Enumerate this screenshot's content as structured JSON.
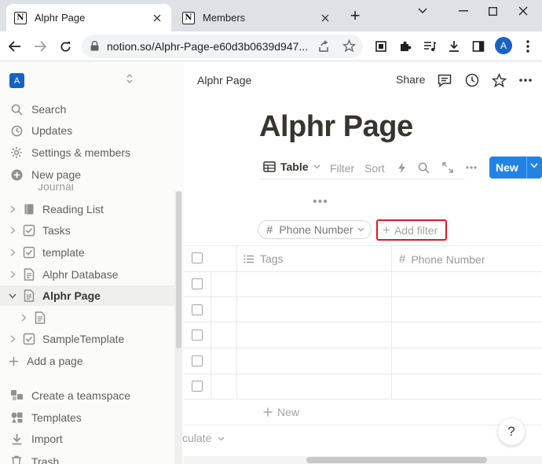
{
  "browser": {
    "tabs": [
      {
        "title": "Alphr Page",
        "active": true
      },
      {
        "title": "Members",
        "active": false
      }
    ],
    "url": "notion.so/Alphr-Page-e60d3b0639d947...",
    "profile_initial": "A"
  },
  "sidebar": {
    "workspace_initial": "A",
    "nav": [
      {
        "label": "Search",
        "icon": "search-icon"
      },
      {
        "label": "Updates",
        "icon": "clock-icon"
      },
      {
        "label": "Settings & members",
        "icon": "gear-icon"
      },
      {
        "label": "New page",
        "icon": "plus-circle-icon"
      }
    ],
    "partial_item": "Journal",
    "pages": [
      {
        "label": "Reading List",
        "icon": "book-icon"
      },
      {
        "label": "Tasks",
        "icon": "checkbox-icon"
      },
      {
        "label": "template",
        "icon": "checkbox-icon"
      },
      {
        "label": "Alphr Database",
        "icon": "page-icon"
      },
      {
        "label": "Alphr Page",
        "icon": "page-icon",
        "active": true,
        "expanded": true
      },
      {
        "label": "",
        "icon": "page-icon",
        "child": true
      },
      {
        "label": "SampleTemplate",
        "icon": "checkbox-icon"
      }
    ],
    "add_page": "Add a page",
    "bottom": [
      {
        "label": "Create a teamspace",
        "icon": "teamspace-icon"
      },
      {
        "label": "Templates",
        "icon": "templates-icon"
      },
      {
        "label": "Import",
        "icon": "import-icon"
      },
      {
        "label": "Trash",
        "icon": "trash-icon"
      }
    ]
  },
  "topbar": {
    "breadcrumb": "Alphr Page",
    "share": "Share"
  },
  "page": {
    "title": "Alphr Page",
    "view": {
      "tab": "Table",
      "filter": "Filter",
      "sort": "Sort",
      "new": "New"
    },
    "filter_chip": "Phone Number",
    "add_filter": "Add filter",
    "more": "•••",
    "table": {
      "columns": [
        {
          "label": "Tags",
          "icon": "list-icon"
        },
        {
          "label": "Phone Number",
          "icon": "hash-icon"
        }
      ],
      "row_count": 5,
      "add_row": "New",
      "calculate": "culate"
    },
    "help": "?"
  },
  "colors": {
    "accent": "#2383e2",
    "highlight_box": "#d71b28",
    "workspace_avatar": "#1565c0",
    "sidebar_bg": "#fbfbfa"
  }
}
